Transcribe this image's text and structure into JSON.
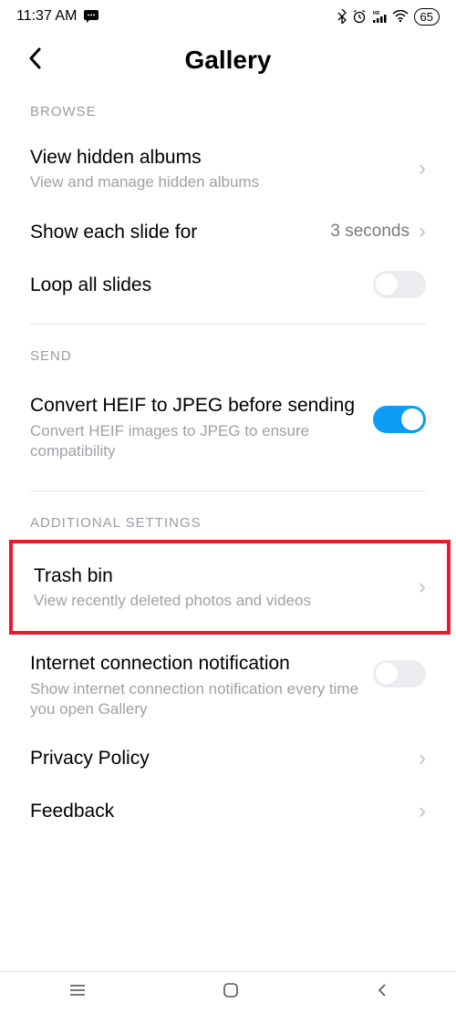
{
  "status": {
    "time": "11:37 AM",
    "battery": "65"
  },
  "header": {
    "title": "Gallery"
  },
  "sections": {
    "browse": {
      "label": "BROWSE",
      "hidden_albums": {
        "title": "View hidden albums",
        "sub": "View and manage hidden albums"
      },
      "slide_duration": {
        "title": "Show each slide for",
        "value": "3 seconds"
      },
      "loop": {
        "title": "Loop all slides",
        "on": false
      }
    },
    "send": {
      "label": "SEND",
      "heif": {
        "title": "Convert HEIF to JPEG before sending",
        "sub": "Convert HEIF images to JPEG to ensure compatibility",
        "on": true
      }
    },
    "additional": {
      "label": "ADDITIONAL SETTINGS",
      "trash": {
        "title": "Trash bin",
        "sub": "View recently deleted photos and videos"
      },
      "internet": {
        "title": "Internet connection notification",
        "sub": "Show internet connection notification every time you open Gallery",
        "on": false
      },
      "privacy": {
        "title": "Privacy Policy"
      },
      "feedback": {
        "title": "Feedback"
      }
    }
  }
}
